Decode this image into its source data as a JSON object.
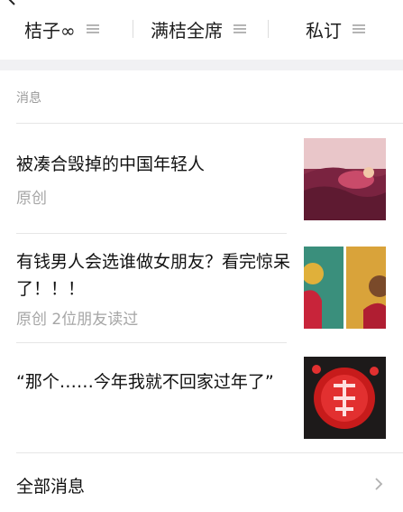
{
  "menu": {
    "items": [
      {
        "label": "桔子∞"
      },
      {
        "label": "满桔全席"
      },
      {
        "label": "私订"
      }
    ],
    "icons": {
      "back": "back-arrow-icon",
      "menu": "menu-lines-icon"
    }
  },
  "section": {
    "title": "消息"
  },
  "articles": [
    {
      "title": "被凑合毁掉的中国年轻人",
      "meta": "原创",
      "thumb": "couple-on-sofa-illustration"
    },
    {
      "title": "有钱男人会选谁做女朋友？看完惊呆了！！！",
      "meta": "原创 2位朋友读过",
      "thumb": "two-women-illustration"
    },
    {
      "title": "“那个……今年我就不回家过年了”",
      "meta": "",
      "thumb": "red-fu-paper-cut"
    }
  ],
  "all_messages": {
    "label": "全部消息",
    "icon": "chevron-right-icon"
  },
  "colors": {
    "text": "#111111",
    "meta": "#a6a6a6",
    "divider": "#e6e6e6",
    "gap": "#f1f1f3"
  }
}
